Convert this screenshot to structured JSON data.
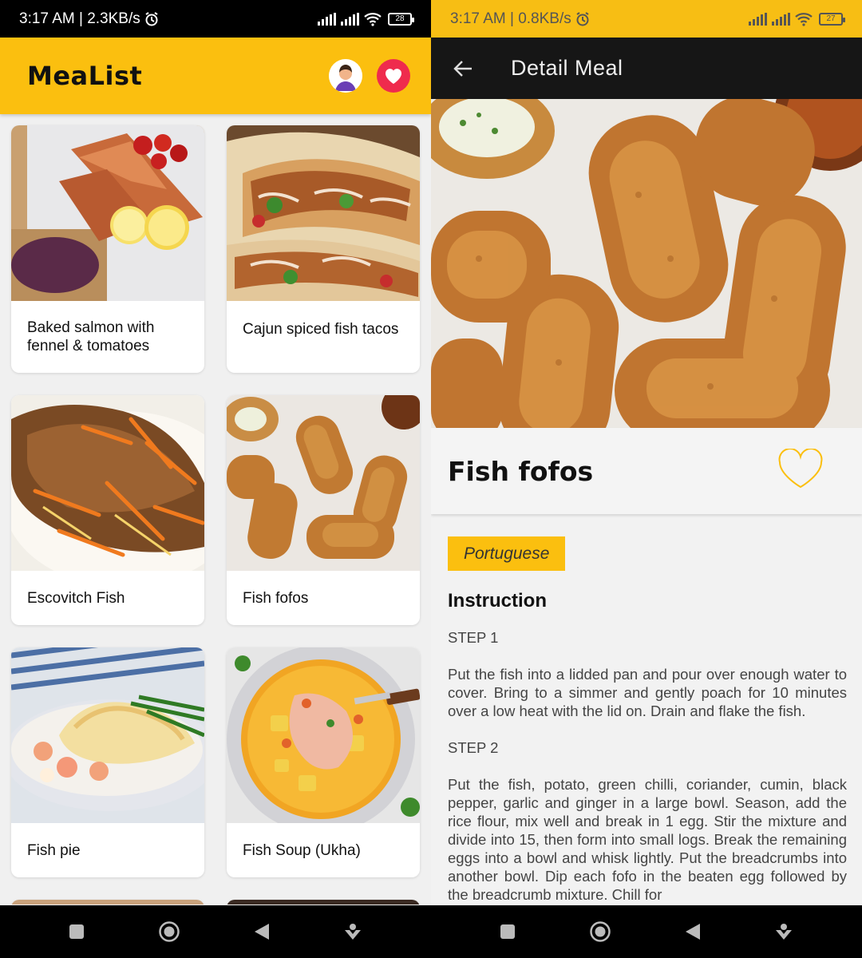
{
  "left": {
    "status": {
      "time": "3:17 AM | 2.3KB/s",
      "battery": "28"
    },
    "appbar": {
      "title": "MeaList"
    },
    "meals": [
      {
        "name": "Baked salmon with fennel & tomatoes"
      },
      {
        "name": "Cajun spiced fish tacos"
      },
      {
        "name": "Escovitch Fish"
      },
      {
        "name": "Fish fofos"
      },
      {
        "name": "Fish pie"
      },
      {
        "name": "Fish Soup (Ukha)"
      }
    ]
  },
  "right": {
    "status": {
      "time": "3:17 AM | 0.8KB/s",
      "battery": "27"
    },
    "topbar": {
      "title": "Detail Meal"
    },
    "meal": {
      "name": "Fish fofos",
      "area": "Portuguese",
      "instruction_heading": "Instruction",
      "instructions": "STEP 1\n\nPut the fish into a lidded pan and pour over enough water to cover. Bring to a simmer and gently poach for 10 minutes over a low heat with the lid on. Drain and flake the fish.\n\nSTEP 2\n\nPut the fish, potato, green chilli, coriander, cumin, black pepper, garlic and ginger in a large bowl. Season, add the rice flour, mix well and break in 1 egg. Stir the mixture and divide into 15, then form into small logs. Break the remaining eggs into a bowl and whisk lightly. Put the breadcrumbs into another bowl. Dip each fofo in the beaten egg followed by the breadcrumb mixture. Chill for"
    }
  },
  "colors": {
    "accent": "#fbbf0f",
    "favorite": "#ef2b4d",
    "toolbar_dark": "#161616"
  }
}
